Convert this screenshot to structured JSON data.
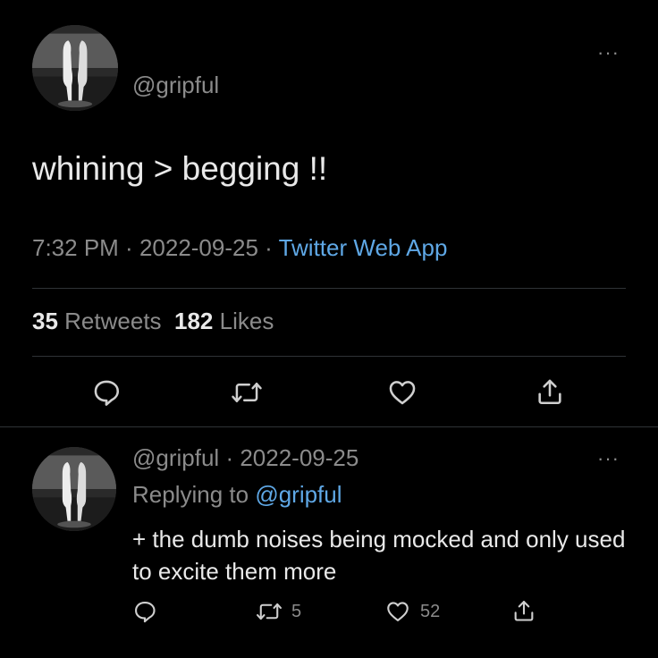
{
  "tweet": {
    "handle": "@gripful",
    "more_label": "···",
    "text": "whining > begging !!",
    "time": "7:32 PM",
    "sep1": " · ",
    "date": "2022-09-25",
    "sep2": " · ",
    "source": "Twitter Web App",
    "retweets_count": "35",
    "retweets_label": "Retweets",
    "likes_count": "182",
    "likes_label": "Likes",
    "actions": [
      "reply-icon",
      "retweet-icon",
      "heart-icon",
      "share-icon"
    ]
  },
  "reply": {
    "handle": "@gripful",
    "sep": " · ",
    "date": "2022-09-25",
    "more_label": "···",
    "replying_prefix": "Replying to ",
    "replying_handle": "@gripful",
    "text": "+ the dumb noises being mocked and only used to excite them more",
    "retweet_count": "5",
    "like_count": "52"
  },
  "colors": {
    "background": "#000000",
    "text": "#e9e9e9",
    "muted": "#8b8b8b",
    "link": "#5fa8e6",
    "divider": "#2f3336"
  }
}
